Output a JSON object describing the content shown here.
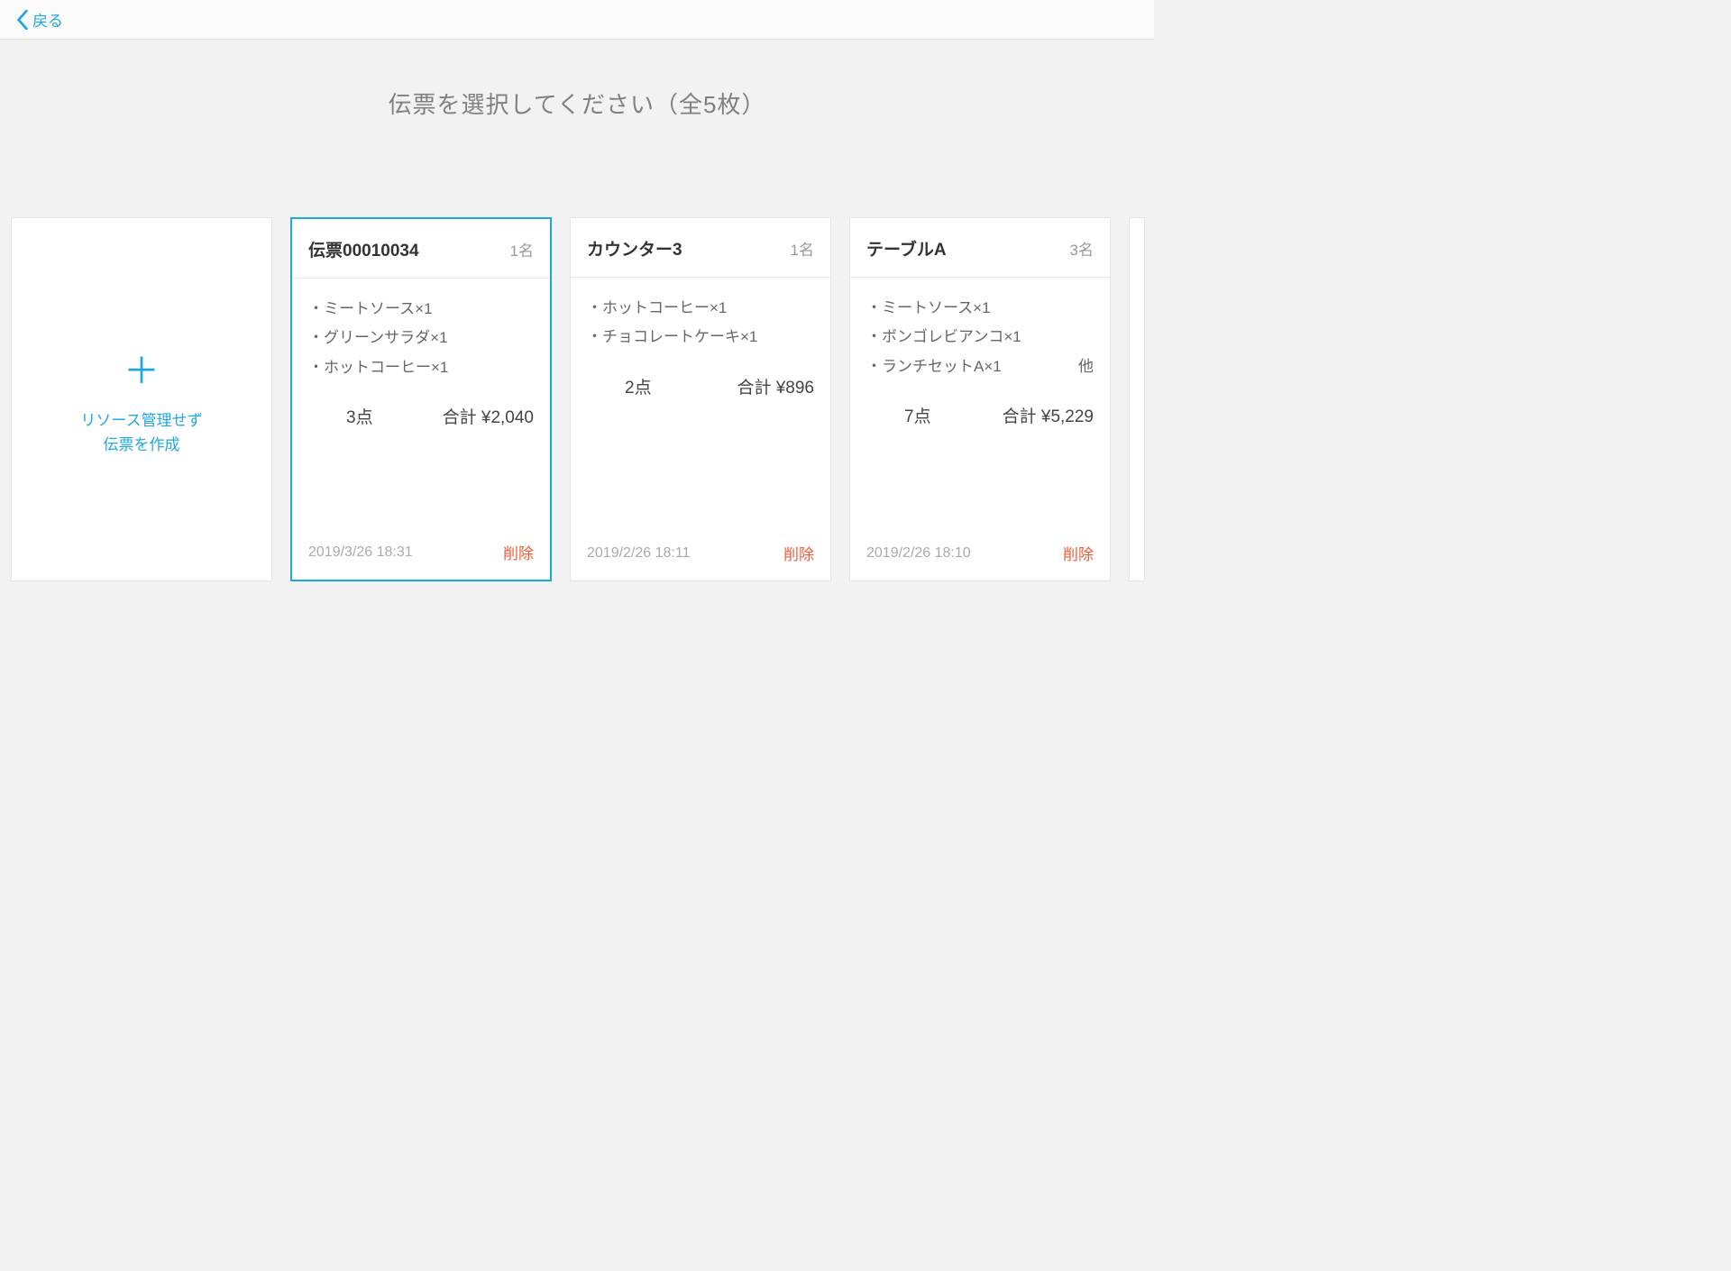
{
  "header": {
    "back_label": "戻る"
  },
  "page": {
    "title": "伝票を選択してください（全5枚）"
  },
  "create_card": {
    "line1": "リソース管理せず",
    "line2": "伝票を作成"
  },
  "slips": [
    {
      "title": "伝票00010034",
      "people": "1名",
      "items": [
        {
          "text": "・ミートソース×1"
        },
        {
          "text": "・グリーンサラダ×1"
        },
        {
          "text": "・ホットコーヒー×1"
        }
      ],
      "points": "3点",
      "total": "合計 ¥2,040",
      "timestamp": "2019/3/26 18:31",
      "delete_label": "削除",
      "selected": true
    },
    {
      "title": "カウンター3",
      "people": "1名",
      "items": [
        {
          "text": "・ホットコーヒー×1"
        },
        {
          "text": "・チョコレートケーキ×1"
        }
      ],
      "points": "2点",
      "total": "合計 ¥896",
      "timestamp": "2019/2/26 18:11",
      "delete_label": "削除",
      "selected": false
    },
    {
      "title": "テーブルA",
      "people": "3名",
      "items": [
        {
          "text": "・ミートソース×1"
        },
        {
          "text": "・ボンゴレビアンコ×1"
        },
        {
          "text": "・ランチセットA×1",
          "extra": "他"
        }
      ],
      "points": "7点",
      "total": "合計 ¥5,229",
      "timestamp": "2019/2/26 18:10",
      "delete_label": "削除",
      "selected": false
    }
  ]
}
